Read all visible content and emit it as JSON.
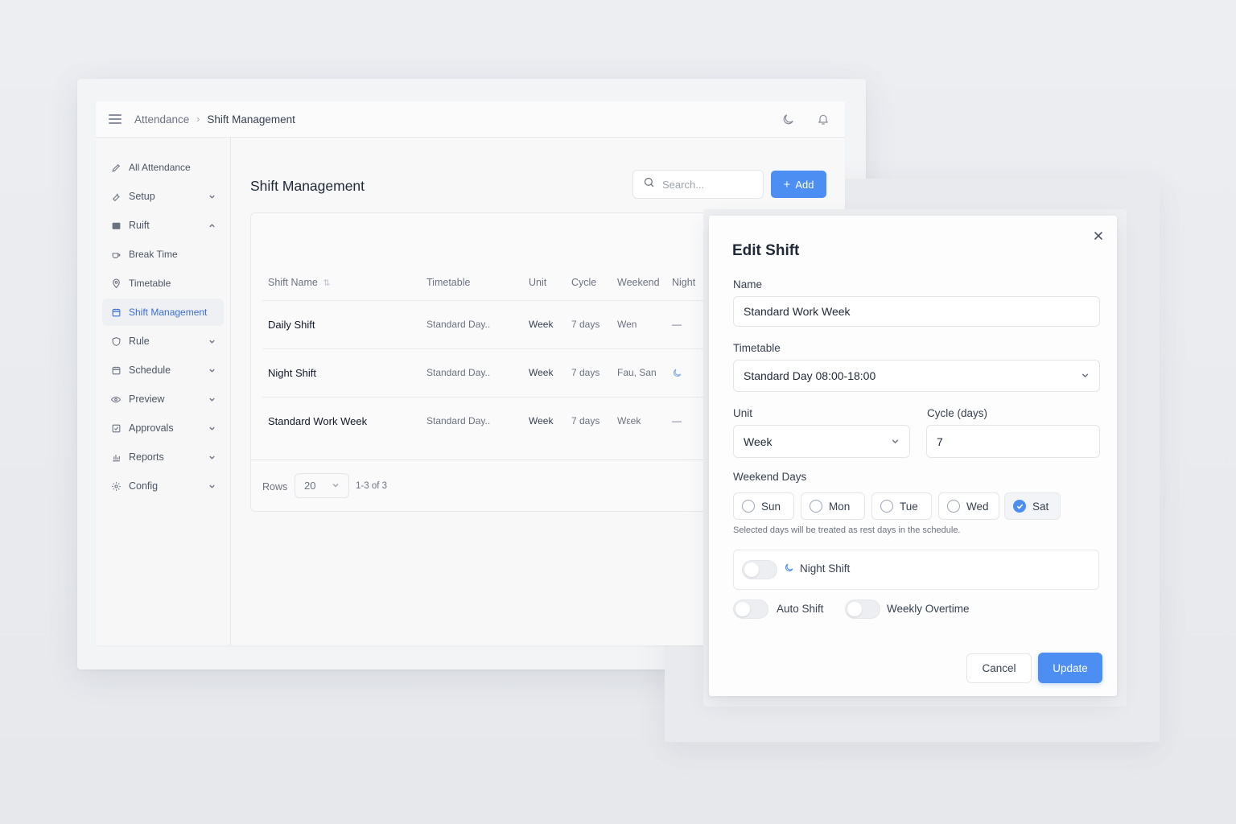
{
  "breadcrumb": {
    "parent": "Attendance",
    "current": "Shift Management"
  },
  "topbar": {
    "theme_icon": "moon-icon",
    "notifications_icon": "bell-icon"
  },
  "sidebar": {
    "items": [
      {
        "label": "All Attendance",
        "icon": "pen-icon"
      },
      {
        "label": "Setup",
        "icon": "wrench-icon",
        "expand": "chevron-down"
      },
      {
        "label": "Ruift",
        "icon": "folder-icon",
        "expand": "chevron-up"
      },
      {
        "label": "Break Time",
        "icon": "coffee-icon",
        "sub": true
      },
      {
        "label": "Timetable",
        "icon": "location-pin-icon",
        "sub": true
      },
      {
        "label": "Shift Management",
        "icon": "calendar-icon",
        "active": true
      },
      {
        "label": "Rule",
        "icon": "shield-icon",
        "expand": "chevron-down"
      },
      {
        "label": "Schedule",
        "icon": "calendar-icon",
        "expand": "chevron-down"
      },
      {
        "label": "Preview",
        "icon": "eye-icon",
        "expand": "chevron-down"
      },
      {
        "label": "Approvals",
        "icon": "check-square-icon",
        "expand": "chevron-down"
      },
      {
        "label": "Reports",
        "icon": "bar-chart-icon",
        "expand": "chevron-down"
      },
      {
        "label": "Config",
        "icon": "gear-icon",
        "expand": "chevron-down"
      }
    ]
  },
  "main": {
    "title": "Shift Management",
    "search_placeholder": "Search...",
    "add_label": "Add",
    "table": {
      "columns": [
        "Shift Name",
        "Timetable",
        "Unit",
        "Cycle",
        "Weekend",
        "Night"
      ],
      "rows": [
        {
          "name": "Daily Shift",
          "timetable": "Standard Day..",
          "unit": "Week",
          "cycle": "7 days",
          "weekend": "Wen",
          "night": "—"
        },
        {
          "name": "Night Shift",
          "timetable": "Standard Day..",
          "unit": "Week",
          "cycle": "7 days",
          "weekend": "Fau, San",
          "night": "moon-icon"
        },
        {
          "name": "Standard Work Week",
          "timetable": "Standard Day..",
          "unit": "Week",
          "cycle": "7 days",
          "weekend": "Wεek",
          "night": "—"
        }
      ]
    },
    "pagination": {
      "rows_label": "Rows",
      "rows_value": "20",
      "range": "1-3 of 3"
    }
  },
  "dialog": {
    "title": "Edit Shift",
    "name_label": "Name",
    "name_value": "Standard Work Week",
    "timetable_label": "Timetable",
    "timetable_value": "Standard Day 08:00-18:00",
    "unit_label": "Unit",
    "unit_value": "Week",
    "cycle_label": "Cycle (days)",
    "cycle_value": "7",
    "weekend_label": "Weekend Days",
    "days": [
      {
        "label": "Sun",
        "checked": false
      },
      {
        "label": "Mon",
        "checked": false
      },
      {
        "label": "Tue",
        "checked": false
      },
      {
        "label": "Wed",
        "checked": false
      },
      {
        "label": "Sat",
        "checked": true
      }
    ],
    "hint": "Selected days will be treated as rest days in the schedule.",
    "night_shift_label": "Night Shift",
    "auto_shift_label": "Auto Shift",
    "weekly_overtime_label": "Weekly Overtime",
    "cancel_label": "Cancel",
    "update_label": "Update"
  },
  "colors": {
    "accent": "#4d8ef2",
    "active_nav": "#3b6fd8"
  }
}
